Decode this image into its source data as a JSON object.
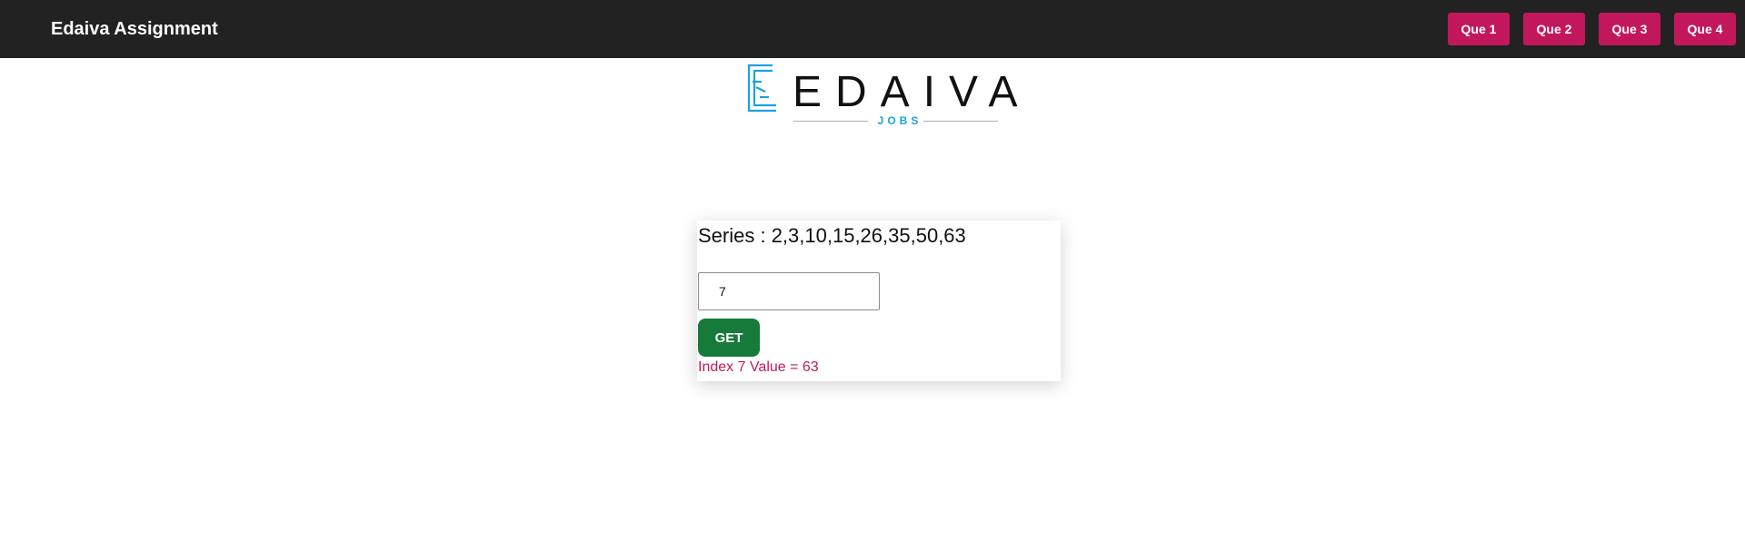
{
  "header": {
    "title": "Edaiva Assignment",
    "nav": [
      {
        "label": "Que 1"
      },
      {
        "label": "Que 2"
      },
      {
        "label": "Que 3"
      },
      {
        "label": "Que 4"
      }
    ],
    "bg_color": "#222222",
    "button_color": "#c2185b"
  },
  "logo": {
    "wordmark": "EDAIVA",
    "subtitle": "JOBS",
    "accent_color": "#1aa3e0"
  },
  "card": {
    "series_text": "Series : 2,3,10,15,26,35,50,63",
    "index_input_value": "7",
    "get_label": "GET",
    "result_text": "Index 7 Value = 63",
    "get_color": "#157a3a",
    "result_color": "#c2185b"
  }
}
